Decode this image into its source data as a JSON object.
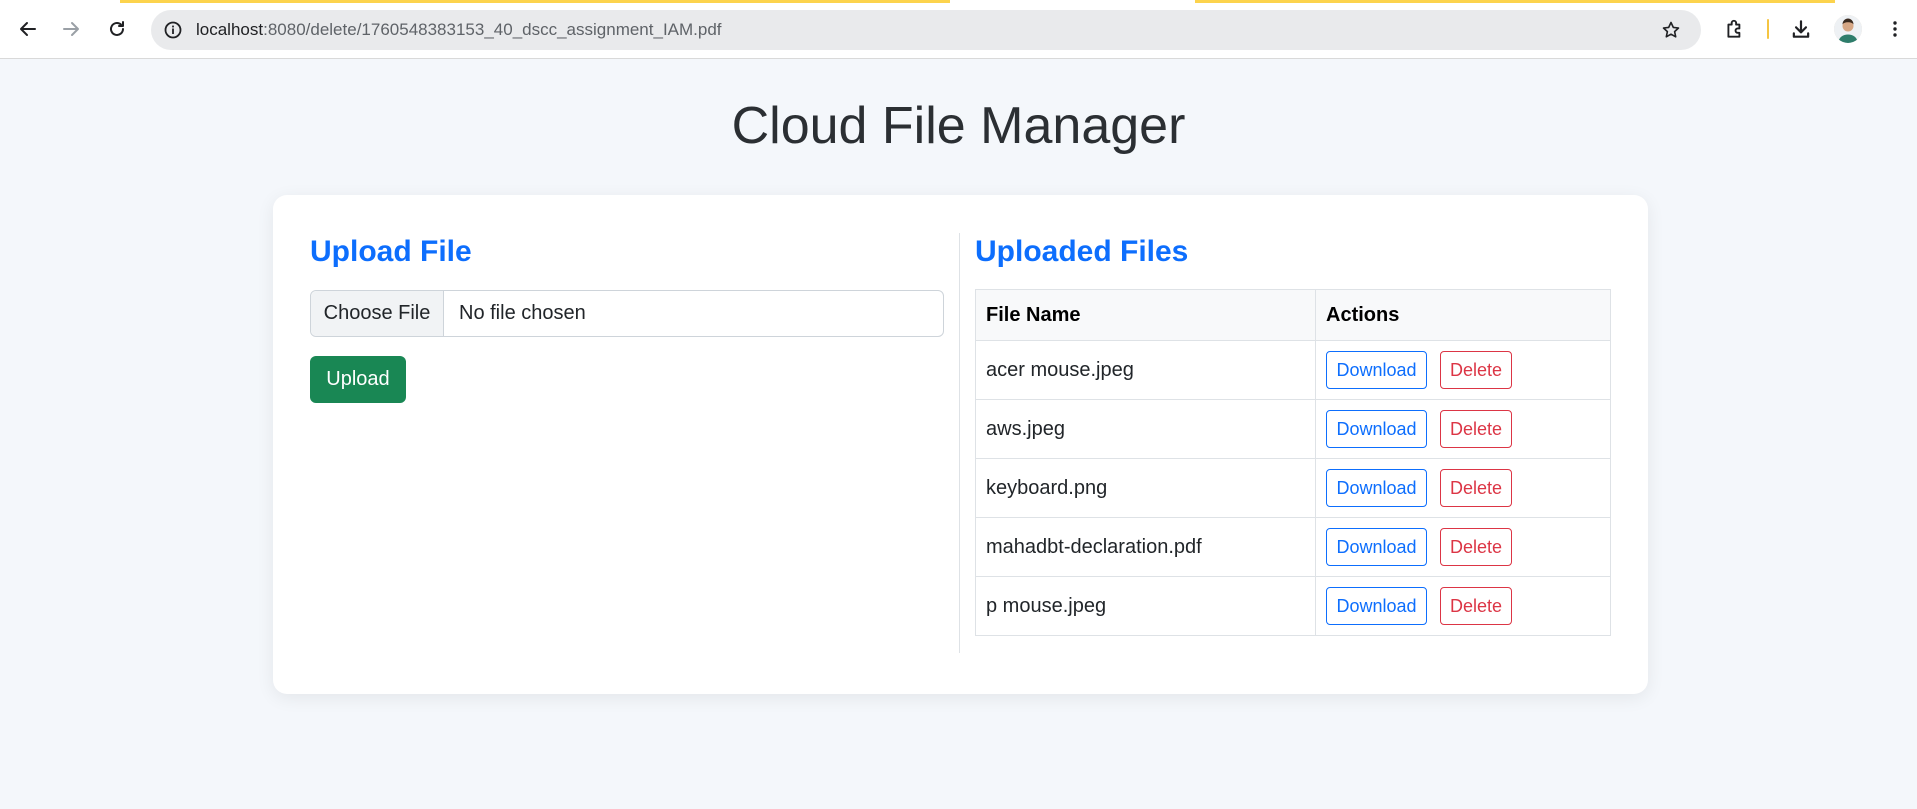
{
  "browser": {
    "url_host": "localhost",
    "url_path": ":8080/delete/1760548383153_40_dscc_assignment_IAM.pdf",
    "icons": [
      "back-arrow-icon",
      "forward-arrow-icon",
      "reload-icon",
      "site-info-icon",
      "bookmark-star-icon",
      "extensions-icon",
      "download-icon",
      "profile-avatar",
      "more-menu-icon"
    ]
  },
  "page": {
    "title": "Cloud File Manager"
  },
  "upload": {
    "heading": "Upload File",
    "choose_label": "Choose File",
    "file_status": "No file chosen",
    "upload_label": "Upload"
  },
  "files": {
    "heading": "Uploaded Files",
    "columns": [
      "File Name",
      "Actions"
    ],
    "rows": [
      {
        "name": "acer mouse.jpeg",
        "download": "Download",
        "delete": "Delete"
      },
      {
        "name": "aws.jpeg",
        "download": "Download",
        "delete": "Delete"
      },
      {
        "name": "keyboard.png",
        "download": "Download",
        "delete": "Delete"
      },
      {
        "name": "mahadbt-declaration.pdf",
        "download": "Download",
        "delete": "Delete"
      },
      {
        "name": "p mouse.jpeg",
        "download": "Download",
        "delete": "Delete"
      }
    ]
  },
  "colors": {
    "primary": "#0d6efd",
    "success": "#198754",
    "danger": "#dc3545",
    "background": "#f4f7fb"
  }
}
